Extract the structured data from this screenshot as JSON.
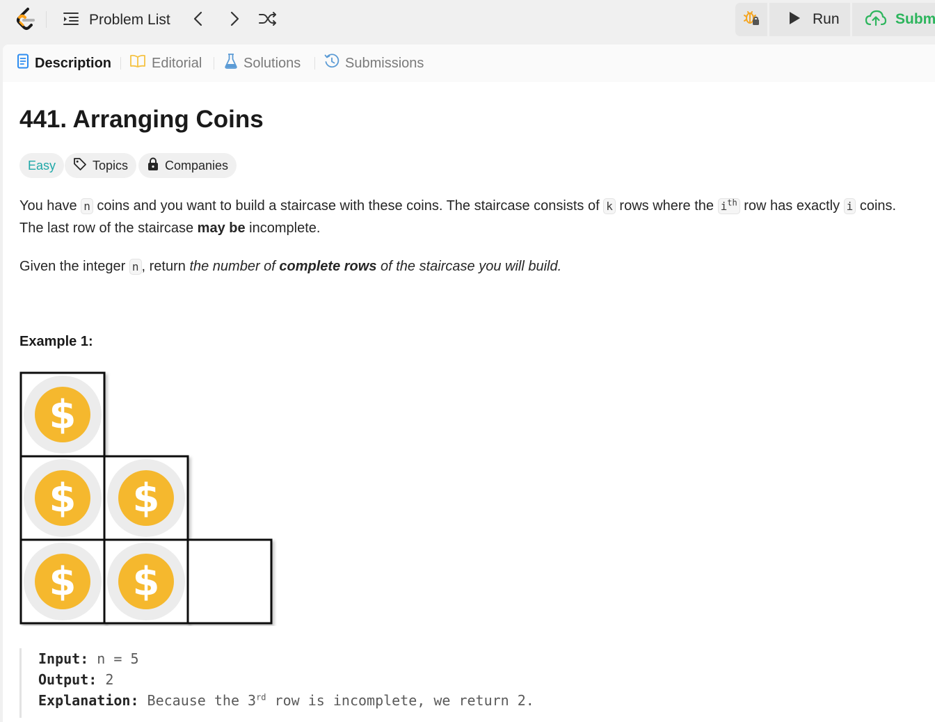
{
  "header": {
    "problem_list_label": "Problem List",
    "run_label": "Run",
    "submit_label": "Submit",
    "icons": {
      "logo": "leetcode-logo-icon",
      "list": "list-icon",
      "prev": "chevron-left-icon",
      "next": "chevron-right-icon",
      "random": "shuffle-icon",
      "debug": "bug-lock-icon",
      "run": "play-icon",
      "submit": "cloud-upload-icon"
    },
    "colors": {
      "submit": "#2db55d",
      "logo_orange": "#ffa116",
      "debug_orange": "#f5a623"
    }
  },
  "tabs": [
    {
      "label": "Description",
      "icon": "document-icon",
      "active": true,
      "color": "#2d8cf0"
    },
    {
      "label": "Editorial",
      "icon": "book-icon",
      "active": false,
      "color": "#f5c242"
    },
    {
      "label": "Solutions",
      "icon": "flask-icon",
      "active": false,
      "color": "#5b9bd5"
    },
    {
      "label": "Submissions",
      "icon": "history-icon",
      "active": false,
      "color": "#5b9bd5"
    }
  ],
  "problem": {
    "title": "441. Arranging Coins",
    "difficulty": "Easy",
    "difficulty_color": "#1fa8a8",
    "topics_label": "Topics",
    "companies_label": "Companies",
    "p1": {
      "t1": "You have ",
      "c1": "n",
      "t2": " coins and you want to build a staircase with these coins. The staircase consists of ",
      "c2": "k",
      "t3": " rows where the ",
      "c3": "i",
      "c3_sup": "th",
      "t4": " row has exactly ",
      "c4": "i",
      "t5": " coins.",
      "line2a": "The last row of the staircase ",
      "line2b": "may be",
      "line2c": " incomplete."
    },
    "p2": {
      "t1": "Given the integer ",
      "c1": "n",
      "t2": ", return ",
      "i1": "the number of ",
      "b1": "complete rows",
      "i2": " of the staircase you will build."
    },
    "example_heading": "Example 1:",
    "example": {
      "input_label": "Input:",
      "input_value": " n = 5",
      "output_label": "Output:",
      "output_value": " 2",
      "explanation_label": "Explanation:",
      "explanation_a": " Because the 3",
      "explanation_sup": "rd",
      "explanation_b": " row is incomplete, we return 2."
    },
    "staircase": {
      "rows": [
        [
          true
        ],
        [
          true,
          true
        ],
        [
          true,
          true,
          false
        ]
      ],
      "coin_symbol": "$",
      "coin_color": "#f5b82e"
    }
  }
}
